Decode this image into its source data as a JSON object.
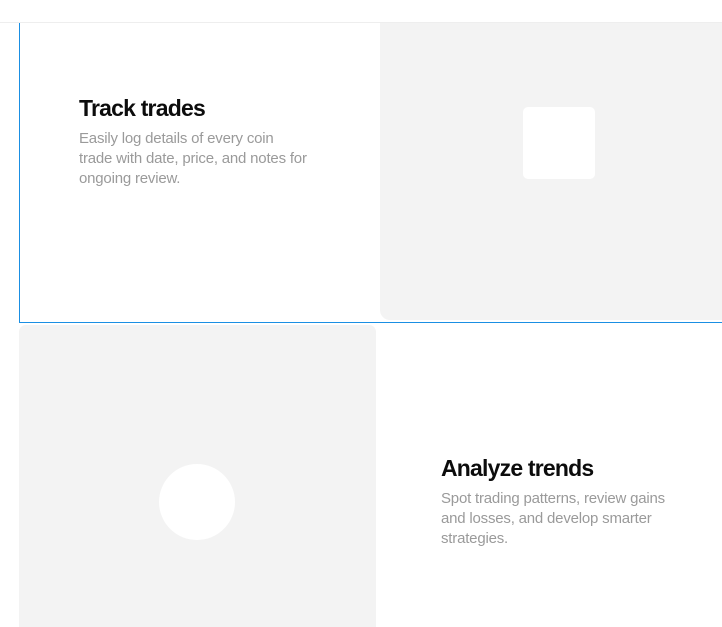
{
  "features": [
    {
      "title": "Track trades",
      "description": "Easily log details of every coin trade with date, price, and notes for ongoing review.",
      "media_placeholder": "square"
    },
    {
      "title": "Analyze trends",
      "description": "Spot trading patterns, review gains and losses, and develop smarter strategies.",
      "media_placeholder": "circle"
    }
  ],
  "colors": {
    "accent_border": "#1a8fe3",
    "media_background": "#f3f3f3",
    "title_text": "#0c0c0c",
    "description_text": "#9a9a9a"
  }
}
